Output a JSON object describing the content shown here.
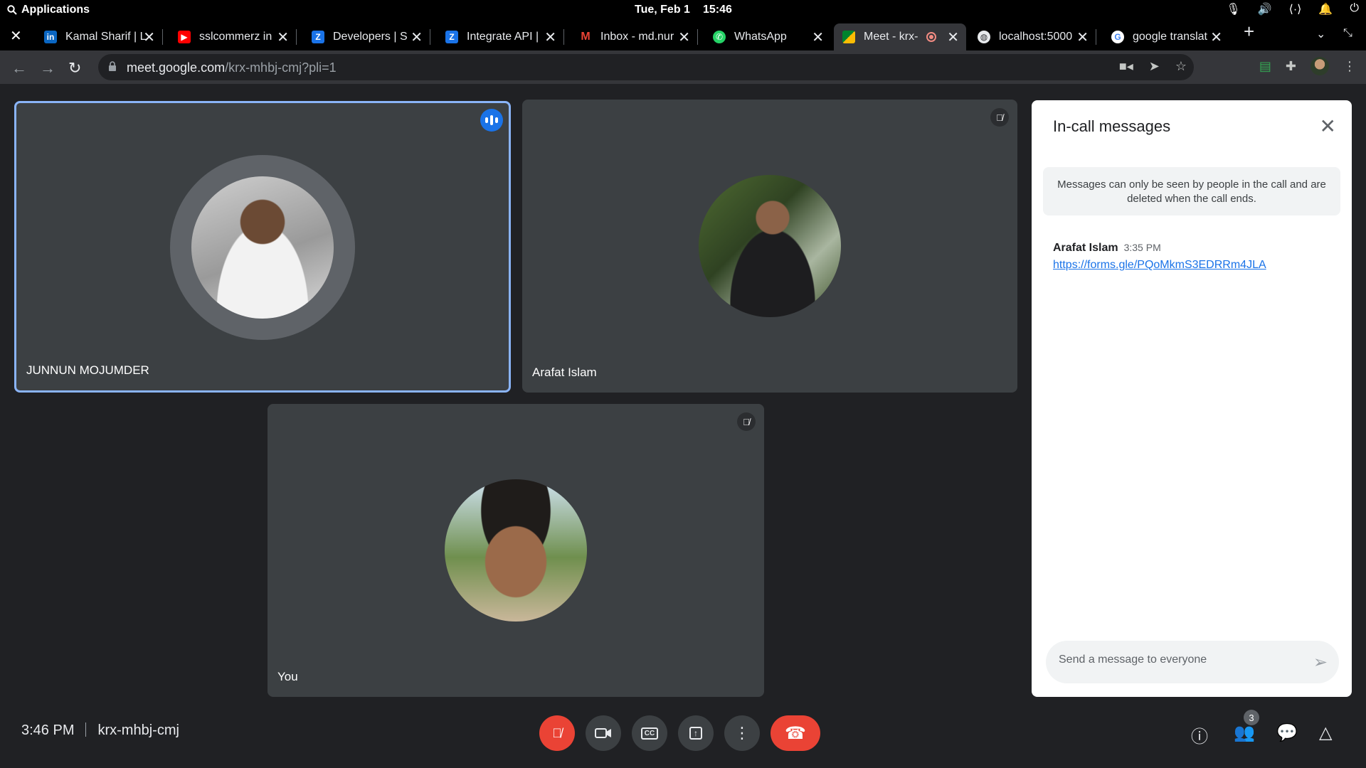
{
  "system": {
    "apps_label": "Applications",
    "date": "Tue, Feb 1",
    "time": "15:46"
  },
  "tabs": [
    {
      "label": "Kamal Sharif | L",
      "icon": "linkedin-icon",
      "color": "#0a66c2"
    },
    {
      "label": "sslcommerz in",
      "icon": "youtube-icon",
      "color": "#ff0000"
    },
    {
      "label": "Developers | S",
      "icon": "zoho-icon",
      "color": "#1a73e8"
    },
    {
      "label": "Integrate API |",
      "icon": "zoho-icon",
      "color": "#1a73e8"
    },
    {
      "label": "Inbox - md.nur",
      "icon": "gmail-icon",
      "color": "#ea4335"
    },
    {
      "label": "WhatsApp",
      "icon": "whatsapp-icon",
      "color": "#25d366"
    },
    {
      "label": "Meet - krx-",
      "icon": "meet-icon",
      "color": "#00832d"
    },
    {
      "label": "localhost:5000",
      "icon": "globe-icon",
      "color": "#e8eaed"
    },
    {
      "label": "google translat",
      "icon": "google-icon",
      "color": "#4285f4"
    }
  ],
  "address": {
    "host": "meet.google.com",
    "path": "/krx-mhbj-cmj?pli=1"
  },
  "participants": [
    {
      "name": "JUNNUN MOJUMDER",
      "speaking": true,
      "muted": false
    },
    {
      "name": "Arafat Islam",
      "speaking": false,
      "muted": true
    },
    {
      "name": "You",
      "speaking": false,
      "muted": true
    }
  ],
  "panel": {
    "title": "In-call messages",
    "notice": "Messages can only be seen by people in the call and are deleted when the call ends.",
    "messages": [
      {
        "sender": "Arafat Islam",
        "time": "3:35 PM",
        "text": "https://forms.gle/PQoMkmS3EDRRm4JLA"
      }
    ],
    "input_placeholder": "Send a message to everyone"
  },
  "bottom": {
    "time": "3:46 PM",
    "meeting_code": "krx-mhbj-cmj",
    "people_count": "3"
  },
  "colors": {
    "accent": "#8ab4f8",
    "red": "#ea4335",
    "tile": "#3c4043",
    "background": "#202124"
  }
}
